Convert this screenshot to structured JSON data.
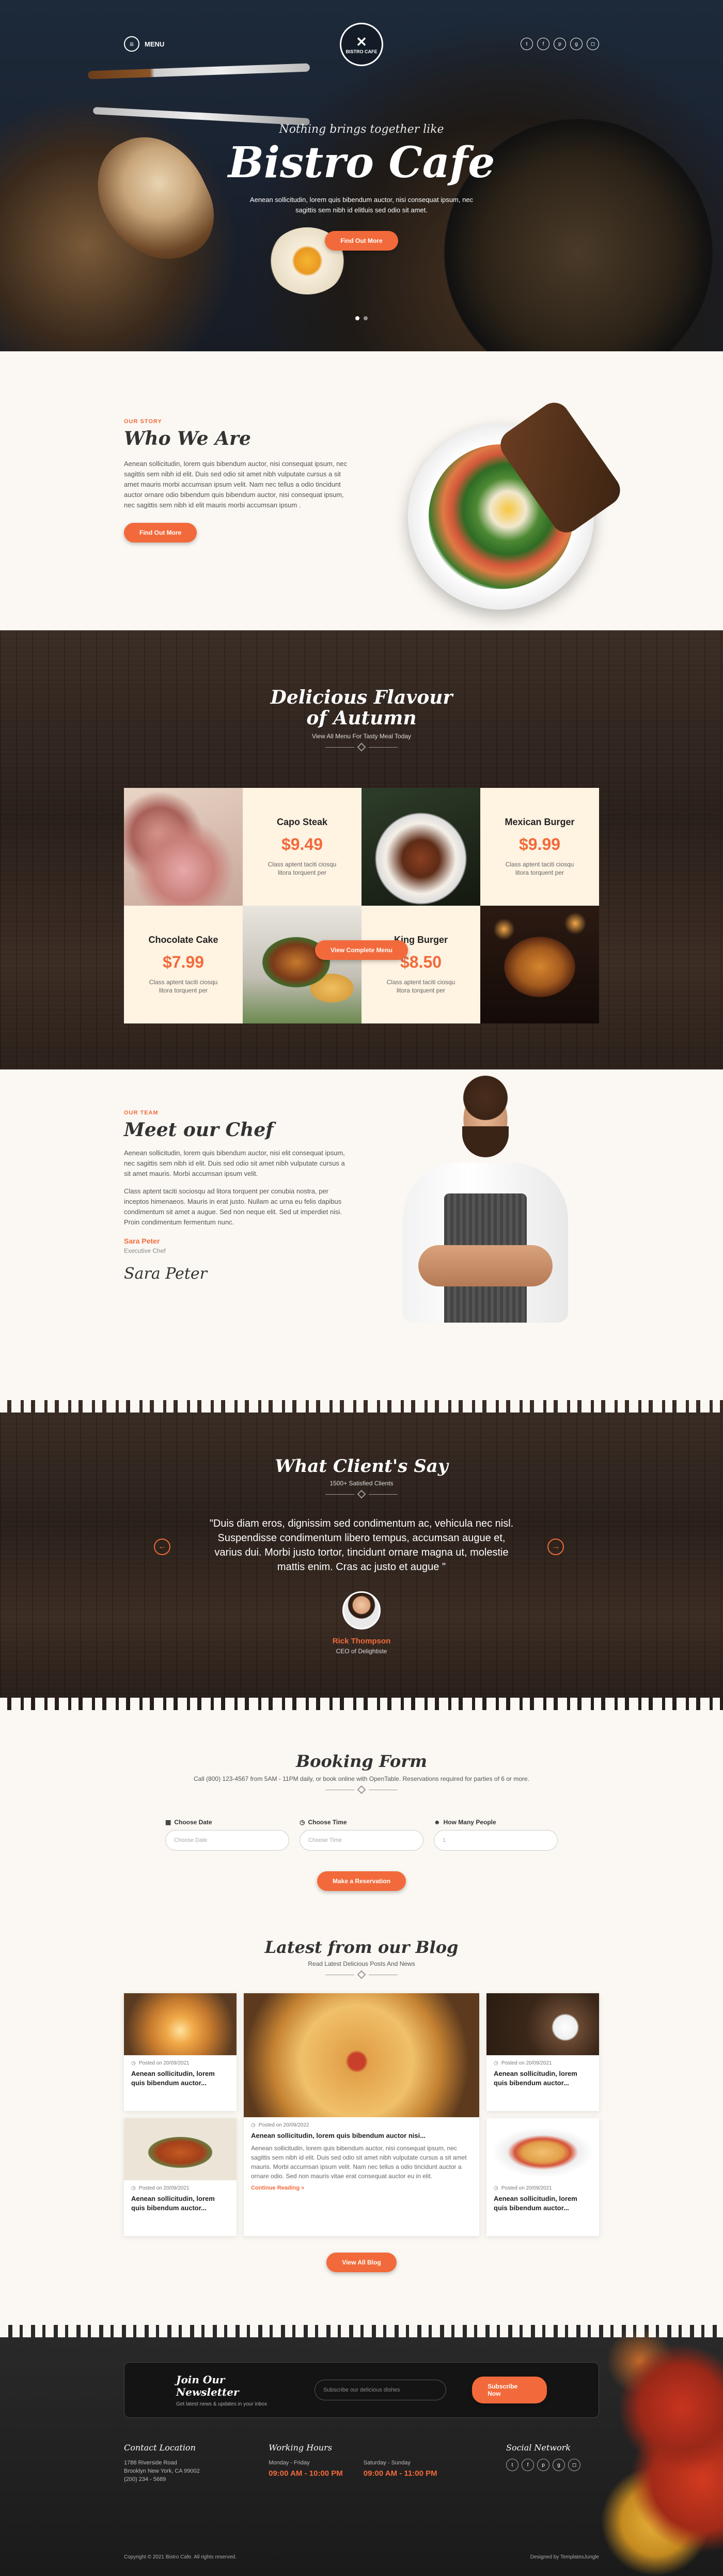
{
  "hero": {
    "menu_label": "MENU",
    "logo_text": "BISTRO CAFE",
    "subtitle": "Nothing brings together like",
    "title": "Bistro Cafe",
    "description": "Aenean sollicitudin, lorem quis bibendum auctor, nisi consequat ipsum, nec sagittis sem nibh id elitluis sed odio sit amet.",
    "button": "Find Out More",
    "socials": [
      "twitter-icon",
      "facebook-icon",
      "pinterest-icon",
      "google-plus-icon",
      "instagram-icon"
    ],
    "social_glyphs": [
      "t",
      "f",
      "p",
      "g",
      "◻"
    ]
  },
  "story": {
    "kicker": "OUR STORY",
    "title": "Who We Are",
    "text": "Aenean sollicitudin, lorem quis bibendum auctor, nisi consequat ipsum, nec sagittis sem nibh id elit. Duis sed odio sit amet nibh vulputate cursus a sit amet mauris morbi accumsan ipsum velit. Nam nec tellus a odio tincidunt auctor ornare odio bibendum quis bibendum auctor, nisi consequat ipsum, nec sagittis sem nibh id elit mauris morbi accumsan ipsum .",
    "button": "Find Out More"
  },
  "menu": {
    "title_line1": "Delicious Flavour",
    "title_line2": "of Autumn",
    "subtitle": "View All Menu For Tasty Meal Today",
    "items": [
      {
        "name": "Capo Steak",
        "price": "$9.49",
        "desc": "Class aptent taciti ciosqu litora torquent per"
      },
      {
        "name": "Mexican Burger",
        "price": "$9.99",
        "desc": "Class aptent taciti ciosqu litora torquent per"
      },
      {
        "name": "Chocolate Cake",
        "price": "$7.99",
        "desc": "Class aptent taciti ciosqu litora torquent per"
      },
      {
        "name": "King Burger",
        "price": "$8.50",
        "desc": "Class aptent taciti ciosqu litora torquent per"
      }
    ],
    "button": "View Complete Menu"
  },
  "chef": {
    "kicker": "OUR TEAM",
    "title": "Meet our Chef",
    "text1": "Aenean sollicitudin, lorem quis bibendum auctor, nisi elit consequat ipsum, nec sagittis sem nibh id elit. Duis sed odio sit amet nibh vulputate cursus a sit amet mauris. Morbi accumsan ipsum velit.",
    "text2": "Class aptent taciti sociosqu ad litora torquent per conubia nostra, per inceptos himenaeos. Mauris in erat justo. Nullam ac urna eu felis dapibus condimentum sit amet a augue. Sed non neque elit. Sed ut imperdiet nisi. Proin condimentum fermentum nunc.",
    "name": "Sara Peter",
    "role": "Executive Chef",
    "signature": "Sara Peter"
  },
  "testimonial": {
    "title": "What Client's Say",
    "subtitle": "1500+ Satisfied Clients",
    "quote": "\"Duis diam eros, dignissim sed condimentum ac, vehicula nec nisl. Suspendisse condimentum libero tempus, accumsan augue et, varius dui. Morbi justo tortor, tincidunt ornare magna ut, molestie mattis enim. Cras ac justo et augue \"",
    "name": "Rick Thompson",
    "role": "CEO of Delightiste"
  },
  "booking": {
    "title": "Booking Form",
    "subtitle": "Call (800) 123-4567 from 5AM - 11PM daily, or book online with OpenTable. Reservations required for parties of 6 or more.",
    "date_label": "Choose Date",
    "date_placeholder": "Choose Date",
    "time_label": "Choose Time",
    "time_placeholder": "Choose Time",
    "people_label": "How Many People",
    "people_placeholder": "1",
    "button": "Make a Reservation"
  },
  "blog": {
    "title": "Latest from our Blog",
    "subtitle": "Read Latest Delicious Posts And News",
    "posts": [
      {
        "date": "Posted on 20/09/2021",
        "title": "Aenean sollicitudin, lorem quis bibendum auctor..."
      },
      {
        "date": "Posted on 20/09/2021",
        "title": "Aenean sollicitudin, lorem quis bibendum auctor..."
      },
      {
        "date": "Posted on 20/09/2022",
        "title": "Aenean sollicitudin, lorem quis bibendum auctor nisi...",
        "text": "Aenean sollicitudin, lorem quis bibendum auctor, nisi consequat ipsum, nec sagittis sem nibh id elit. Duis sed odio sit amet nibh vulputate cursus a sit amet mauris. Morbi accumsan ipsum velit. Nam nec tellus a odio tincidunt auctor a ornare odio. Sed non mauris vitae erat consequat auctor eu in elit.",
        "more": "Continue Reading »"
      },
      {
        "date": "Posted on 20/09/2021",
        "title": "Aenean sollicitudin, lorem quis bibendum auctor..."
      },
      {
        "date": "Posted on 20/09/2021",
        "title": "Aenean sollicitudin, lorem quis bibendum auctor..."
      }
    ],
    "button": "View All Blog"
  },
  "footer": {
    "newsletter_title": "Join Our Newsletter",
    "newsletter_text": "Get latest news & updates in your inbox",
    "newsletter_placeholder": "Subscribe our delicious dishes",
    "newsletter_button": "Subscribe Now",
    "contact_title": "Contact Location",
    "contact_lines": [
      "1788 Riverside Road",
      "Brooklyn New York, CA 99002",
      "(200) 234 - 5689"
    ],
    "hours_title": "Working Hours",
    "weekday_label": "Monday - Friday",
    "weekday_hours": "09:00 AM - 10:00 PM",
    "weekend_label": "Saturday - Sunday",
    "weekend_hours": "09:00 AM - 11:00 PM",
    "social_title": "Social Network",
    "copyright": "Copyright © 2021 Bistro Cafe. All rights reserved.",
    "designed_by": "Designed by TemplatesJungle"
  },
  "colors": {
    "accent": "#f26a3b",
    "cream": "#fff3e2",
    "wood": "#3a2d25"
  }
}
